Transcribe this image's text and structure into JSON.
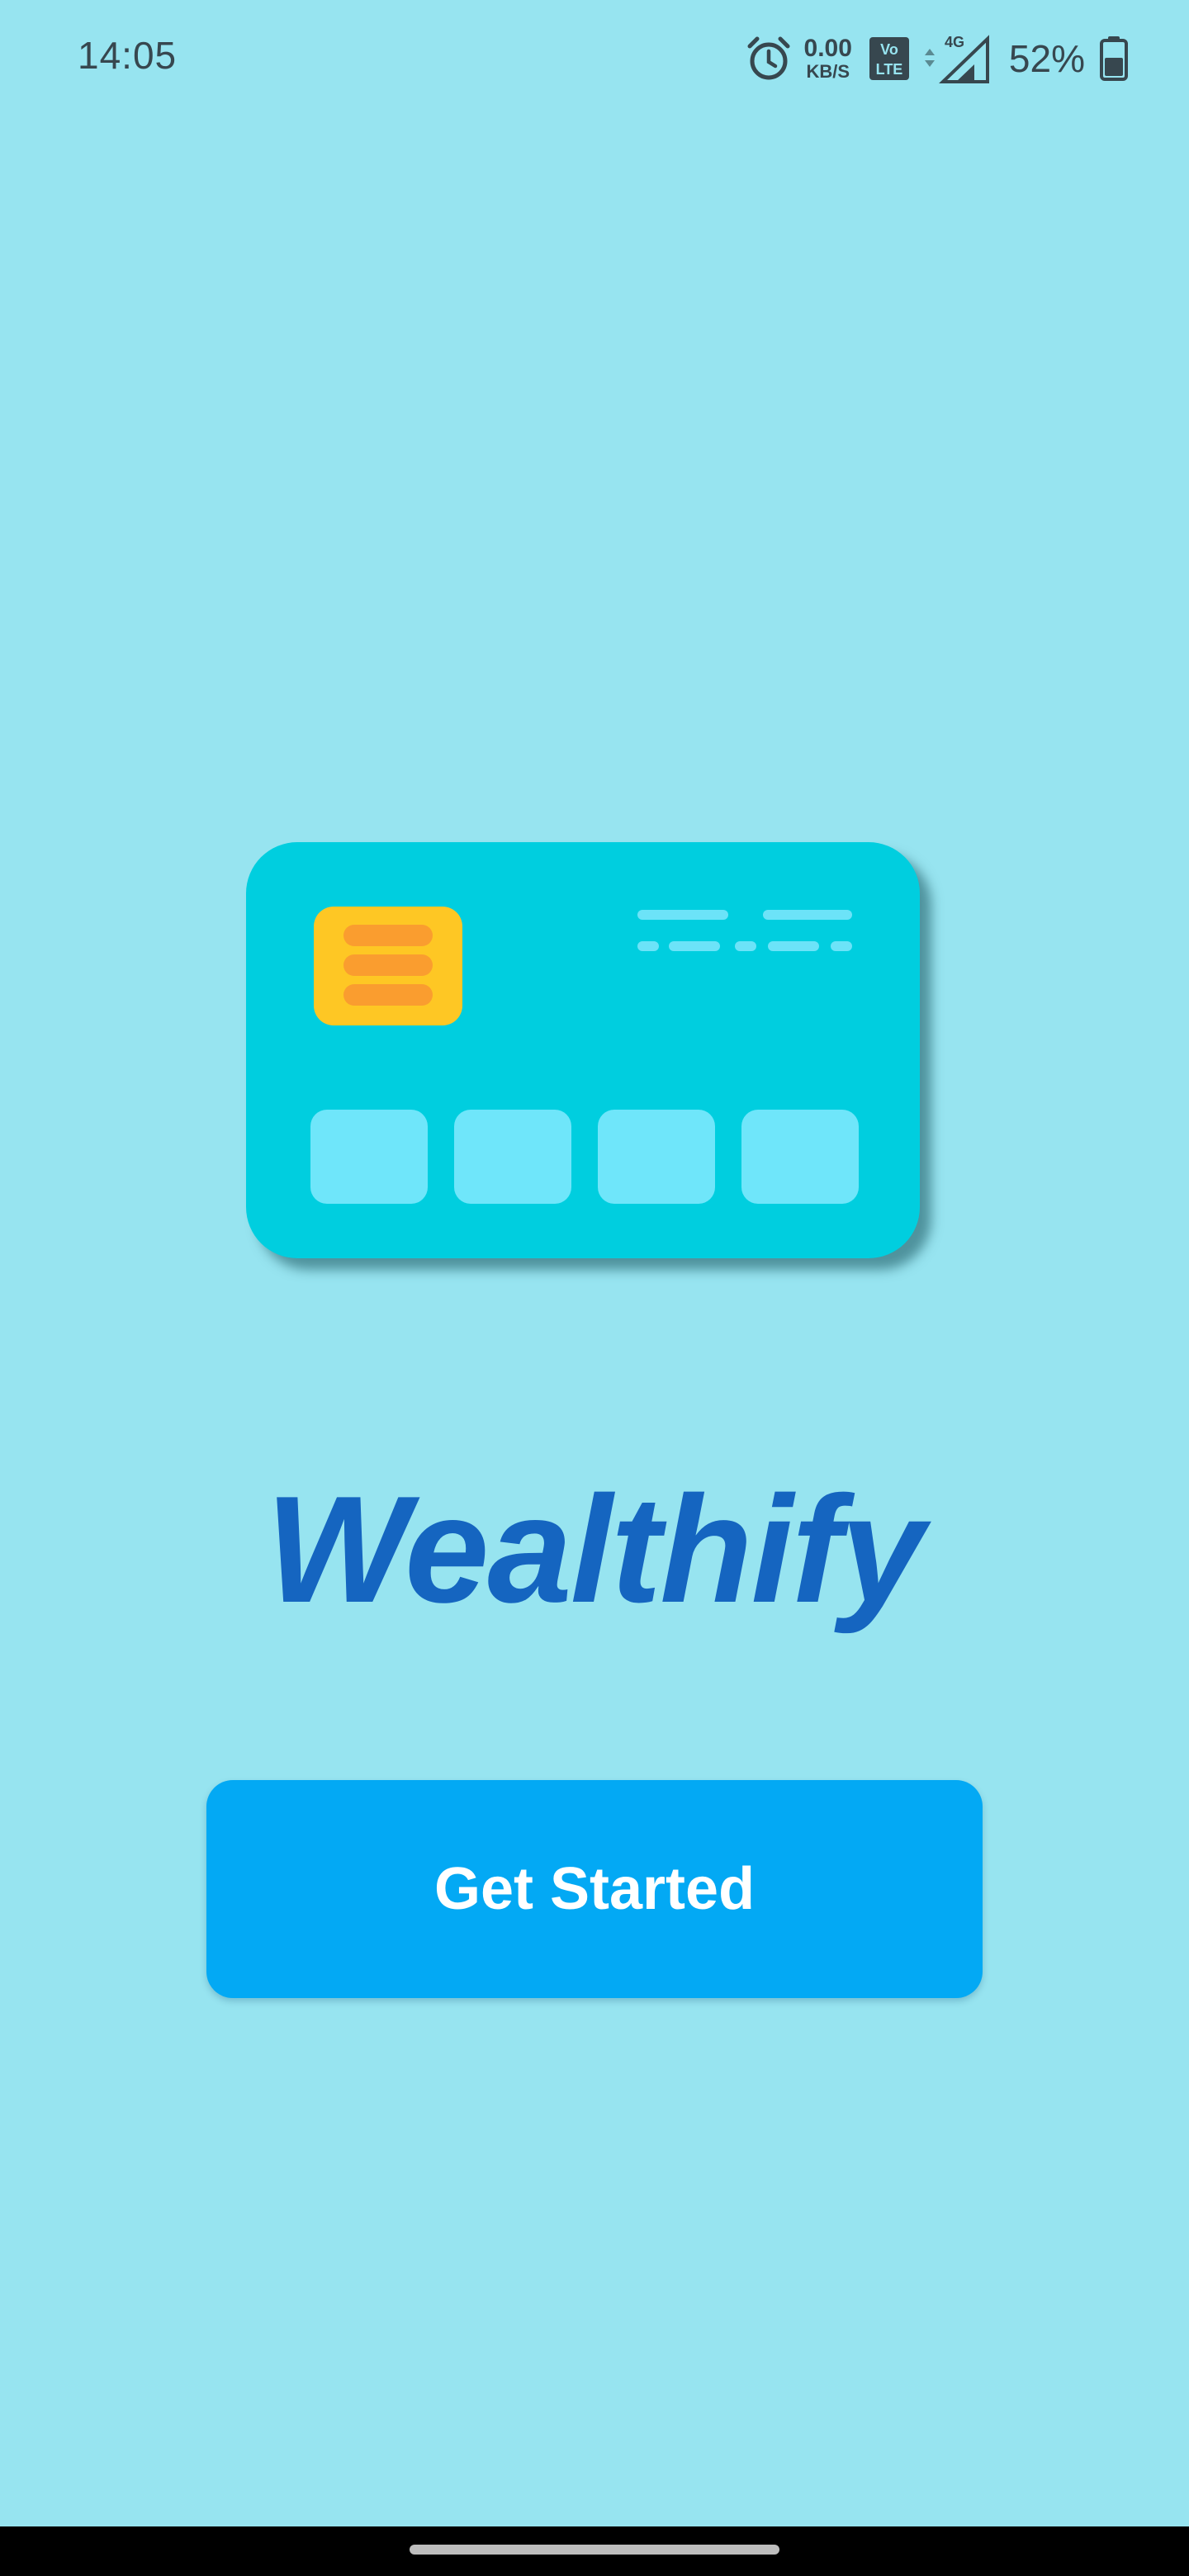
{
  "status_bar": {
    "time": "14:05",
    "net_speed_value": "0.00",
    "net_speed_unit": "KB/S",
    "volte_label_top": "Vo",
    "volte_label_bottom": "LTE",
    "network_type": "4G",
    "battery_percent": "52%",
    "icons": [
      "alarm-icon",
      "volte-icon",
      "signal-icon",
      "battery-icon"
    ]
  },
  "hero": {
    "illustration": "credit-card-illustration",
    "colors": {
      "card": "#00CEDF",
      "chip": "#FEC724",
      "chip_lines": "#FA9D2F",
      "pads": "#6FE6FA",
      "dashes": "#6CE3F8"
    }
  },
  "app": {
    "title": "Wealthify",
    "title_color": "#1565C0"
  },
  "cta": {
    "label": "Get Started",
    "color": "#03A9F4"
  },
  "theme": {
    "background": "#97E4F0"
  }
}
